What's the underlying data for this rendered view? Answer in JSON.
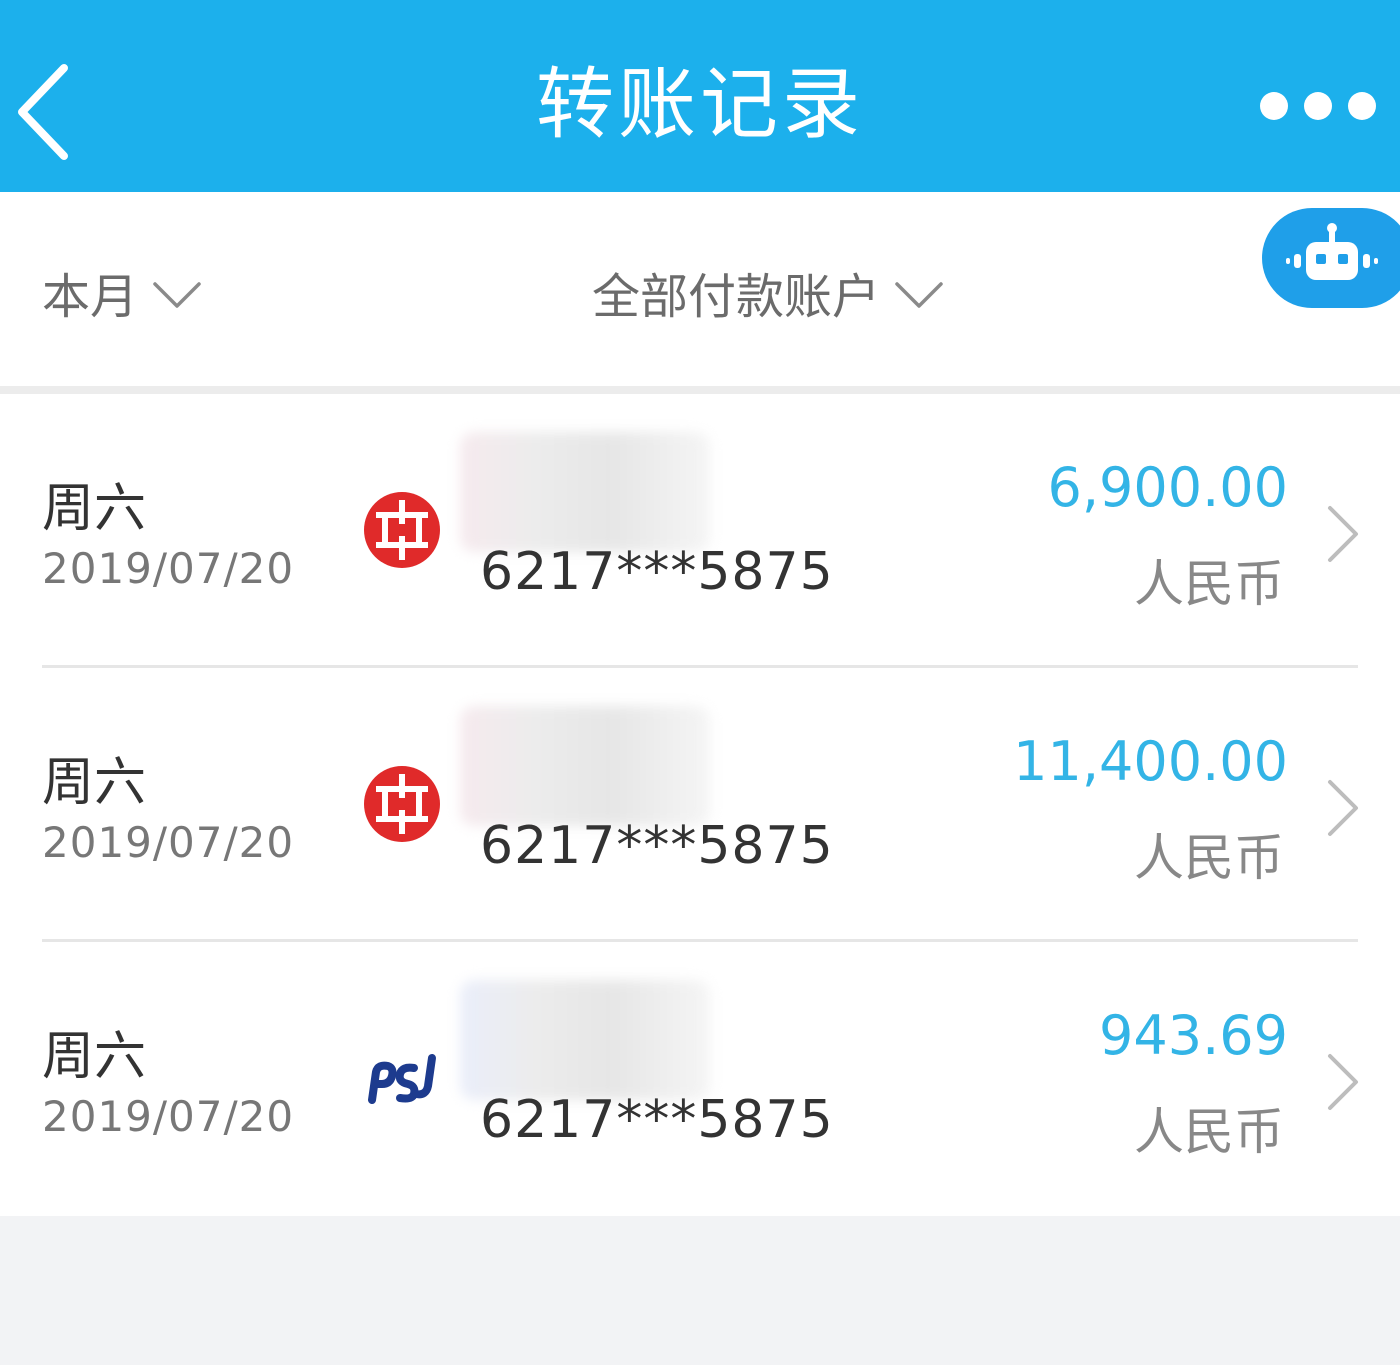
{
  "header": {
    "title": "转账记录",
    "background_color": "#1cb0ec"
  },
  "filters": {
    "period_label": "本月",
    "account_label": "全部付款账户"
  },
  "records": [
    {
      "weekday": "周六",
      "date": "2019/07/20",
      "bank_icon": "citic-bank-logo-icon",
      "account_no": "6217***5875",
      "amount": "6,900.00",
      "currency": "人民币"
    },
    {
      "weekday": "周六",
      "date": "2019/07/20",
      "bank_icon": "citic-bank-logo-icon",
      "account_no": "6217***5875",
      "amount": "11,400.00",
      "currency": "人民币"
    },
    {
      "weekday": "周六",
      "date": "2019/07/20",
      "bank_icon": "spdb-bank-logo-icon",
      "account_no": "6217***5875",
      "amount": "943.69",
      "currency": "人民币"
    }
  ],
  "colors": {
    "amount": "#33b4e6",
    "citic_red": "#e02a2a",
    "spdb_blue": "#1d3b8e"
  }
}
